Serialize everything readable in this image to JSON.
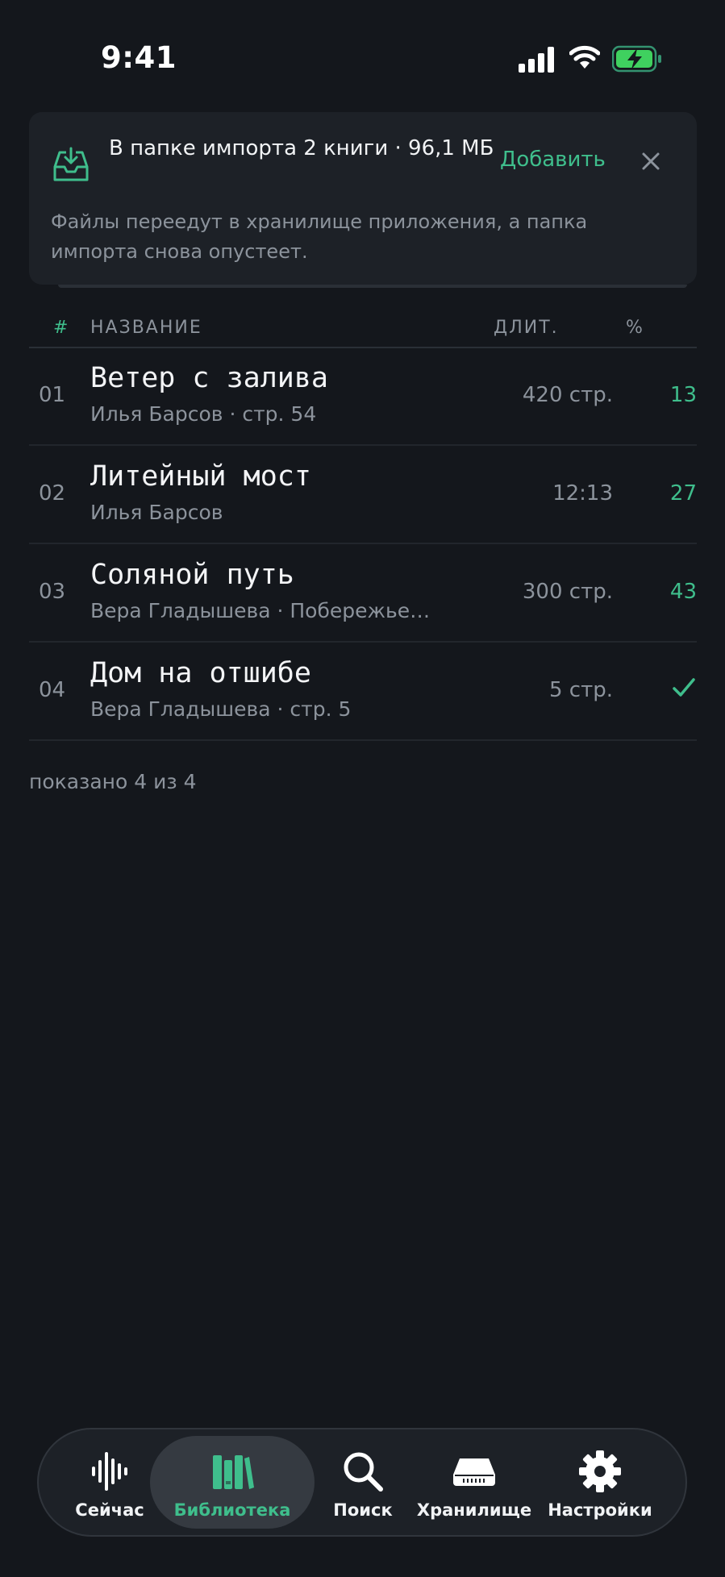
{
  "status_bar": {
    "time": "9:41"
  },
  "import_banner": {
    "title": "В папке импорта 2 книги · 96,1 МБ",
    "add_label": "Добавить",
    "description": "Файлы переедут в хранилище приложения, а папка импорта снова опустеет."
  },
  "table": {
    "headers": {
      "num": "#",
      "name": "НАЗВАНИЕ",
      "duration": "ДЛИТ.",
      "percent": "%"
    },
    "rows": [
      {
        "num": "01",
        "title": "Ветер с залива",
        "subtitle": "Илья Барсов · стр. 54",
        "duration": "420 стр.",
        "percent": "13"
      },
      {
        "num": "02",
        "title": "Литейный мост",
        "subtitle": "Илья Барсов",
        "duration": "12:13",
        "percent": "27"
      },
      {
        "num": "03",
        "title": "Соляной путь",
        "subtitle": "Вера Гладышева · Побережье…",
        "duration": "300 стр.",
        "percent": "43"
      },
      {
        "num": "04",
        "title": "Дом на отшибе",
        "subtitle": "Вера Гладышева · стр. 5",
        "duration": "5 стр.",
        "percent": "",
        "completed_icon": "check-icon"
      }
    ]
  },
  "count_text": "показано 4 из 4",
  "tab_bar": {
    "tabs": [
      {
        "label": "Сейчас",
        "icon": "waveform-icon"
      },
      {
        "label": "Библиотека",
        "icon": "books-icon",
        "active": true
      },
      {
        "label": "Поиск",
        "icon": "search-icon"
      },
      {
        "label": "Хранилище",
        "icon": "storage-drive-icon"
      },
      {
        "label": "Настройки",
        "icon": "gear-icon"
      }
    ]
  },
  "colors": {
    "accent": "#3fbe8c",
    "background": "#14171c",
    "surface": "#1d2127",
    "muted_text": "#8c939c"
  }
}
